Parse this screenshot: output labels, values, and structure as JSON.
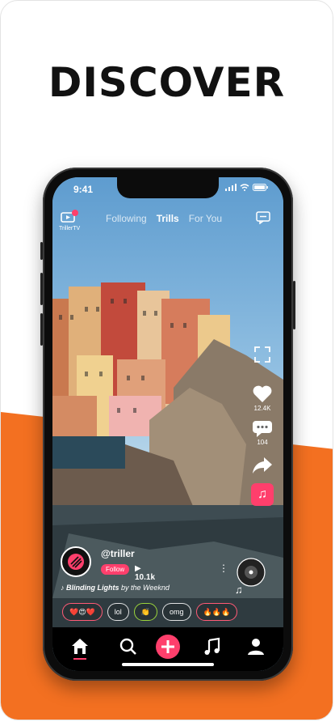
{
  "headline": "DISCOVER",
  "status": {
    "time": "9:41"
  },
  "top_bar": {
    "tv_label": "TrillerTV",
    "tabs": [
      {
        "label": "Following",
        "active": false
      },
      {
        "label": "Trills",
        "active": true
      },
      {
        "label": "For You",
        "active": false
      }
    ]
  },
  "rail": {
    "likes_count": "12.4K",
    "comments_count": "104"
  },
  "creator": {
    "handle": "@triller",
    "follow_label": "Follow",
    "views": "▶ 10.1k"
  },
  "song": {
    "title": "Blinding Lights",
    "by_text": "by the Weeknd"
  },
  "reactions": [
    {
      "label": "❤️😍❤️",
      "style": "r"
    },
    {
      "label": "lol",
      "style": ""
    },
    {
      "label": "👏",
      "style": "y"
    },
    {
      "label": "omg",
      "style": ""
    },
    {
      "label": "🔥🔥🔥",
      "style": "r"
    }
  ],
  "colors": {
    "accent": "#ff3f6c",
    "orange": "#f37021"
  },
  "icons": [
    "triller-tv-icon",
    "message-icon",
    "fullscreen-icon",
    "heart-icon",
    "comment-icon",
    "share-icon",
    "music-note-icon",
    "home-icon",
    "search-icon",
    "plus-icon",
    "music-icon",
    "profile-icon"
  ]
}
